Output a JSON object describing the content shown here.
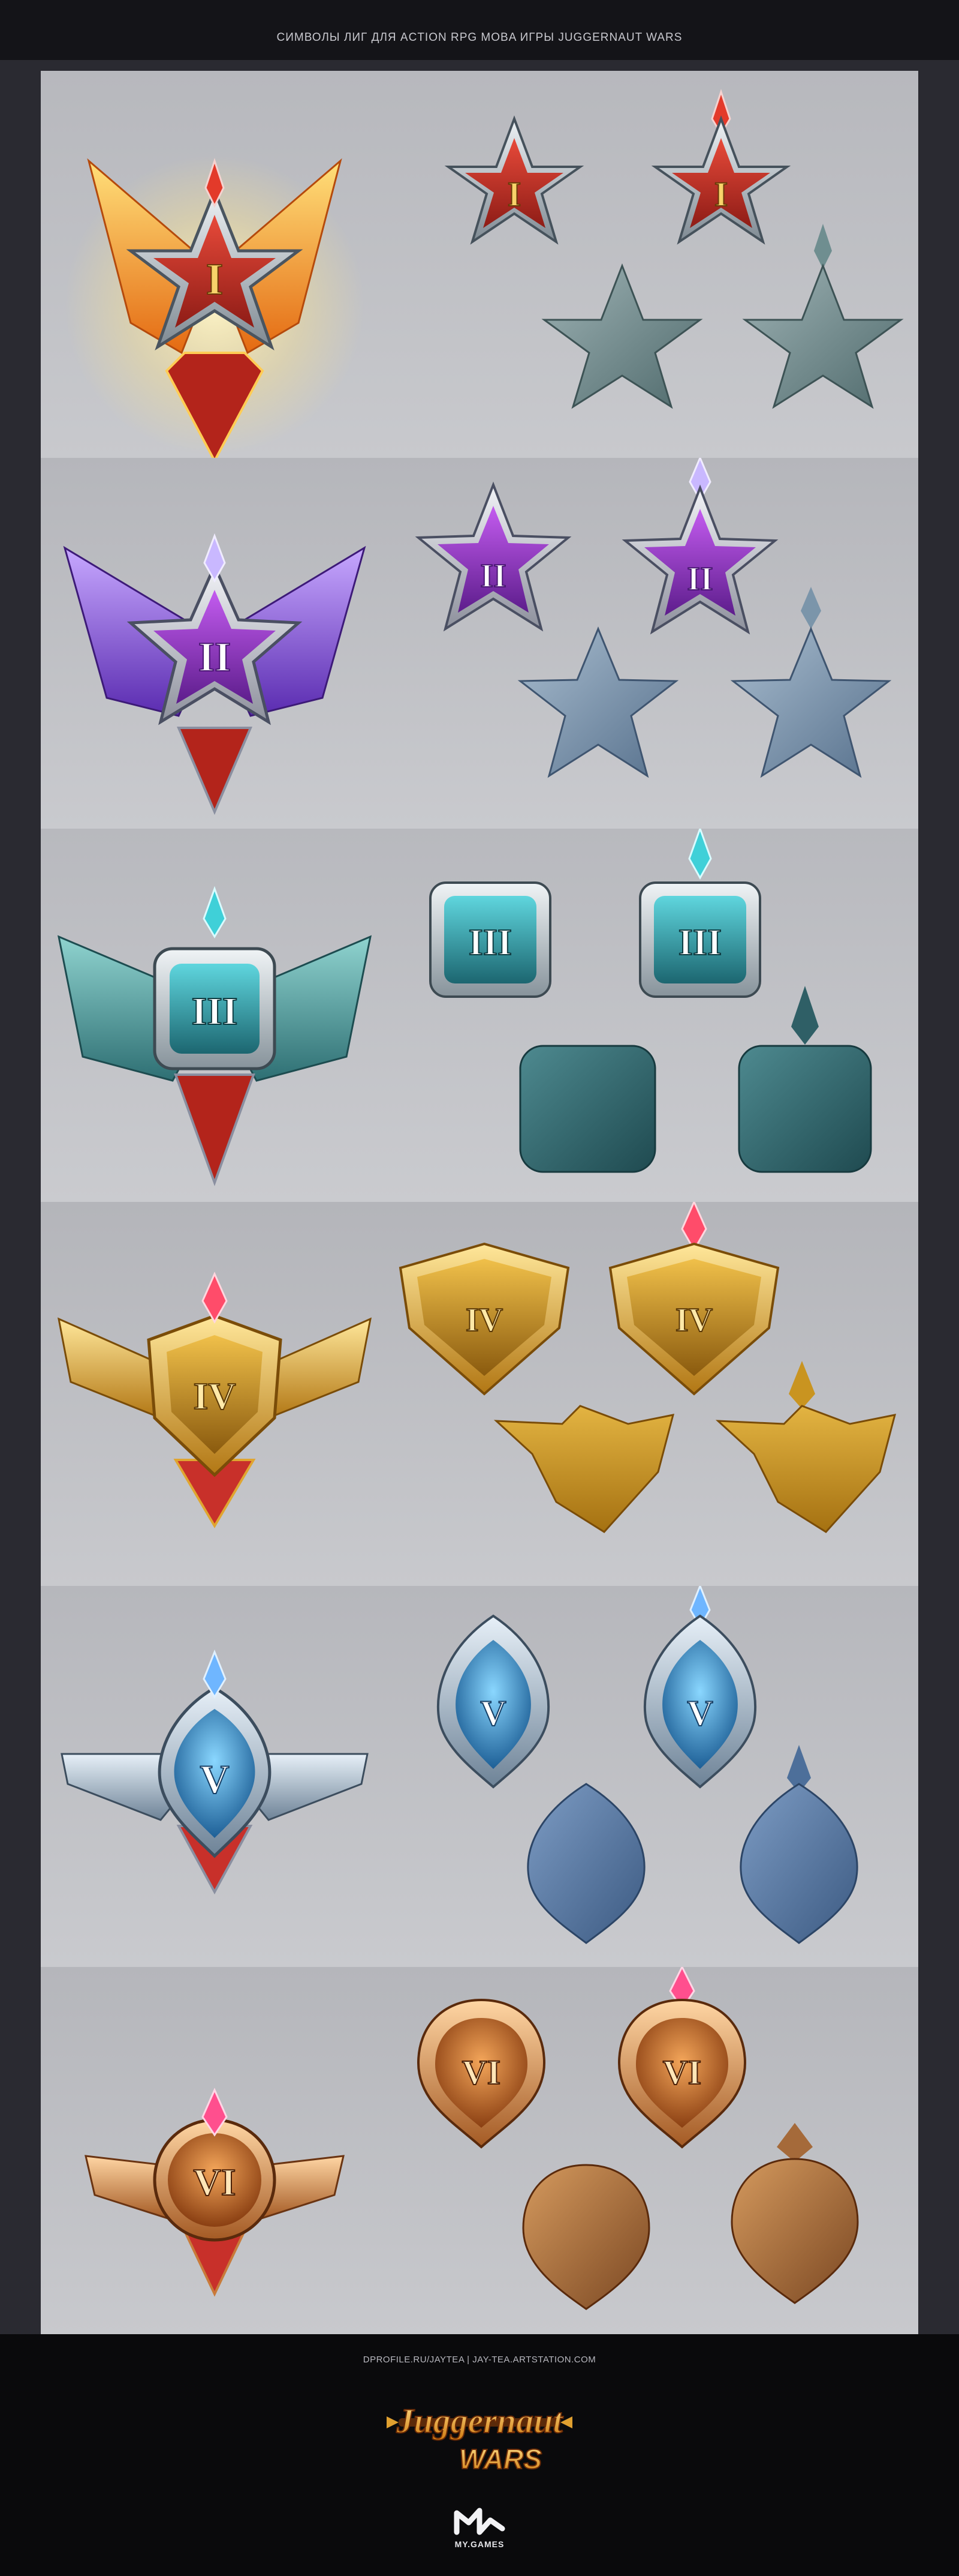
{
  "header": {
    "title": "СИМВОЛЫ ЛИГ ДЛЯ ACTION RPG MOBA ИГРЫ JUGGERNAUT WARS"
  },
  "leagues": [
    {
      "numeral": "I",
      "color": "#c8332a",
      "accent": "#f4b430",
      "blank": "#6f8e90"
    },
    {
      "numeral": "II",
      "color": "#9a3fc8",
      "accent": "#8a6bff",
      "blank": "#7b95aa"
    },
    {
      "numeral": "III",
      "color": "#2c8c96",
      "accent": "#4fd1d9",
      "blank": "#2f5f66"
    },
    {
      "numeral": "IV",
      "color": "#c99420",
      "accent": "#ff4c6a",
      "blank": "#c99420"
    },
    {
      "numeral": "V",
      "color": "#3a95c9",
      "accent": "#6fb6ff",
      "blank": "#4d6f9a"
    },
    {
      "numeral": "VI",
      "color": "#c8702e",
      "accent": "#ff4f8e",
      "blank": "#a56a3a"
    }
  ],
  "footer": {
    "credits": "DPROFILE.RU/JAYTEA  |  JAY-TEA.ARTSTATION.COM",
    "logo_top": "Juggernaut",
    "logo_bottom": "WARS",
    "publisher": "MY.GAMES"
  }
}
